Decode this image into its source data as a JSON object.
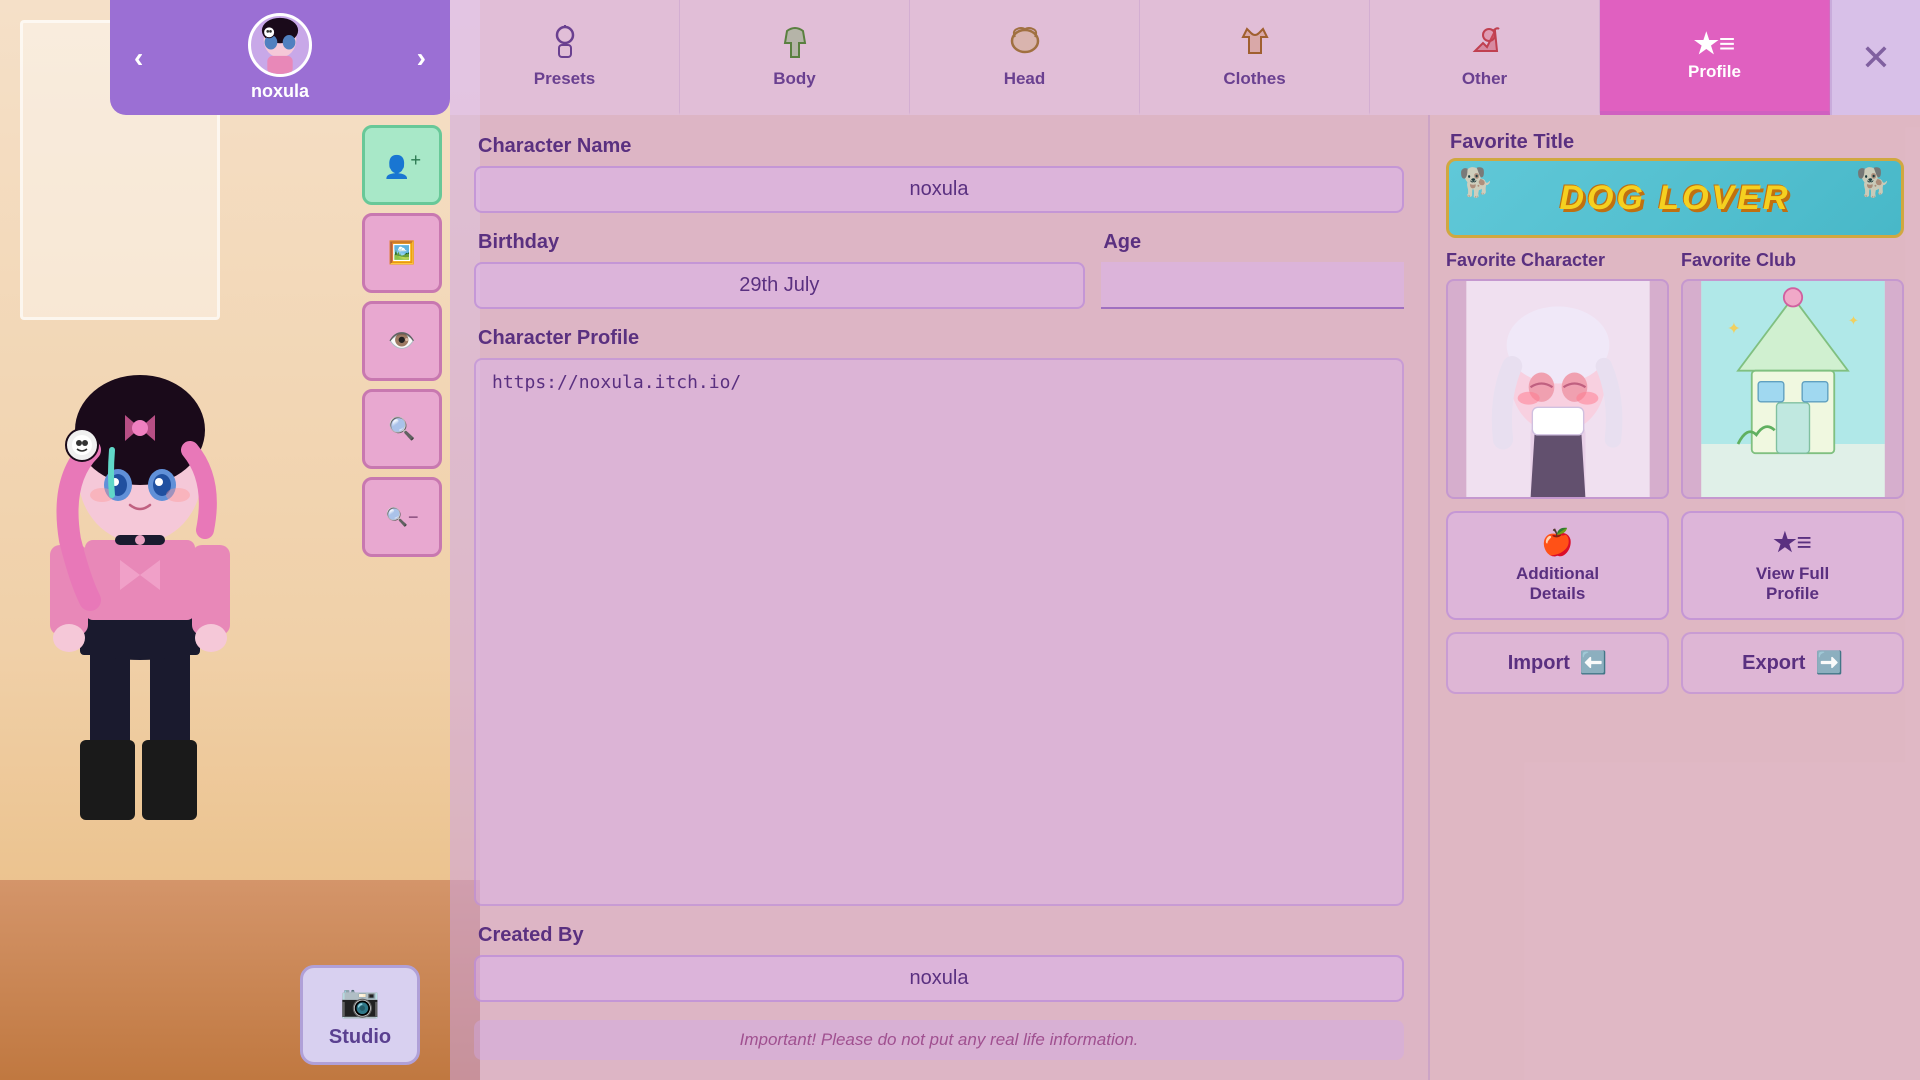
{
  "character": {
    "name": "noxula",
    "avatar_icon": "👤"
  },
  "tabs": [
    {
      "id": "presets",
      "label": "Presets",
      "icon": "🧍",
      "active": false
    },
    {
      "id": "body",
      "label": "Body",
      "icon": "👗",
      "active": false
    },
    {
      "id": "head",
      "label": "Head",
      "icon": "👒",
      "active": false
    },
    {
      "id": "clothes",
      "label": "Clothes",
      "icon": "👕",
      "active": false
    },
    {
      "id": "other",
      "label": "Other",
      "icon": "⚔️",
      "active": false
    },
    {
      "id": "profile",
      "label": "Profile",
      "icon": "★≡",
      "active": true
    }
  ],
  "form": {
    "character_name_label": "Character Name",
    "character_name_value": "noxula",
    "birthday_label": "Birthday",
    "birthday_value": "29th July",
    "age_label": "Age",
    "age_value": "",
    "profile_label": "Character Profile",
    "profile_value": "https://noxula.itch.io/",
    "created_by_label": "Created By",
    "created_by_value": "noxula",
    "important_note": "Important! Please do not put any real life information."
  },
  "profile_panel": {
    "favorite_title_label": "Favorite Title",
    "dog_lover_text": "DOG LOVER",
    "favorite_character_label": "Favorite Character",
    "favorite_club_label": "Favorite Club",
    "additional_details_label": "Additional\nDetails",
    "view_full_profile_label": "View Full\nProfile",
    "import_label": "Import",
    "export_label": "Export"
  },
  "toolbar": {
    "add_icon": "👤+",
    "image_icon": "🖼",
    "eye_icon": "👁",
    "zoom_in_icon": "🔍+",
    "zoom_out_icon": "🔍-"
  },
  "studio": {
    "label": "Studio",
    "icon": "📷"
  },
  "nav": {
    "prev_icon": "‹",
    "next_icon": "›"
  }
}
